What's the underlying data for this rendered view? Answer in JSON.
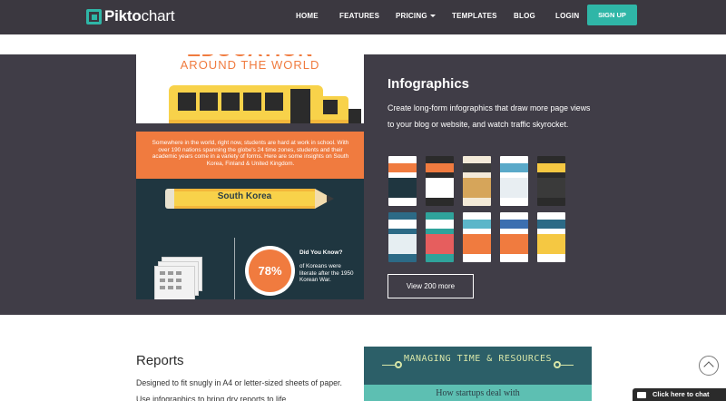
{
  "nav": {
    "brand_bold": "Pikto",
    "brand_thin": "chart",
    "items": [
      "HOME",
      "FEATURES",
      "PRICING",
      "TEMPLATES",
      "BLOG",
      "LOGIN"
    ],
    "signup": "SIGN UP"
  },
  "hero": {
    "infographic": {
      "title": "EDUCATION",
      "subtitle": "AROUND THE WORLD",
      "intro": "Somewhere in the world, right now, students are hard at work in school. With over 190 nations spanning the globe's 24 time zones, students and their academic years come in a variety of forms. Here are some insights on South Korea, Finland & United Kingdom.",
      "country": "South Korea",
      "stat": "78%",
      "did_you_know": "Did You Know?",
      "fact": "of Koreans were literate after the 1950 Korean War."
    },
    "title": "Infographics",
    "description": "Create long-form infographics that draw more page views to your blog or website, and watch traffic skyrocket.",
    "button": "View 200 more",
    "thumbnail_colors": [
      [
        "#ffffff",
        "#f07b3f",
        "#1f3640"
      ],
      [
        "#2b2b2b",
        "#f07b3f",
        "#ffffff"
      ],
      [
        "#f3ead8",
        "#3c3c3c",
        "#d6a55a"
      ],
      [
        "#ffffff",
        "#5aa9c9",
        "#e8eef2"
      ],
      [
        "#2b2b2b",
        "#f5c842",
        "#3a3a3a"
      ],
      [
        "#2c6a86",
        "#ffffff",
        "#e6eef2"
      ],
      [
        "#2fa39b",
        "#ffffff",
        "#e65e5e"
      ],
      [
        "#ffffff",
        "#5cb6c9",
        "#f07b3f"
      ],
      [
        "#ffffff",
        "#3c6fb0",
        "#f07b3f"
      ],
      [
        "#ffffff",
        "#2c6a86",
        "#f5c842"
      ]
    ]
  },
  "reports": {
    "title": "Reports",
    "description": "Designed to fit snugly in A4 or letter-sized sheets of paper. Use infographics to bring dry reports to life.",
    "preview_heading": "MANAGING TIME & RESOURCES",
    "preview_sub": "How startups deal with"
  },
  "chat": {
    "label": "Click here to chat"
  }
}
